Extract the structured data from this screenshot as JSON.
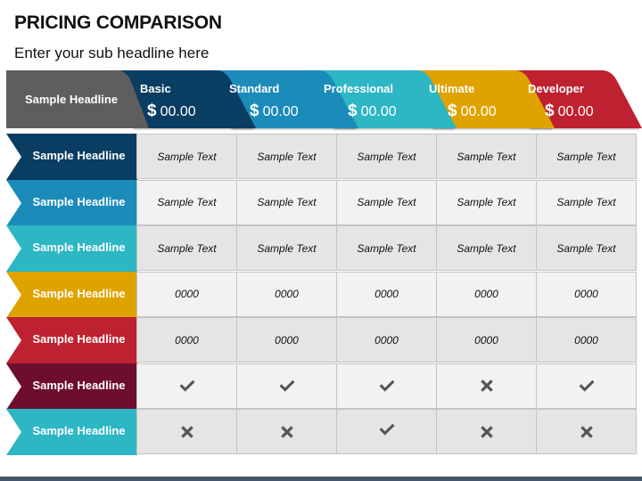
{
  "page": {
    "title": "PRICING COMPARISON",
    "subtitle": "Enter your sub headline here"
  },
  "header": {
    "label": "Sample Headline",
    "label_color": "#5e5e5e",
    "plans": [
      {
        "name": "Basic",
        "currency": "$",
        "price": "00.00",
        "color": "#0a3d62"
      },
      {
        "name": "Standard",
        "currency": "$",
        "price": "00.00",
        "color": "#1b8bba"
      },
      {
        "name": "Professional",
        "currency": "$",
        "price": "00.00",
        "color": "#2db6c4"
      },
      {
        "name": "Ultimate",
        "currency": "$",
        "price": "00.00",
        "color": "#dfa300"
      },
      {
        "name": "Developer",
        "currency": "$",
        "price": "00.00",
        "color": "#be2130"
      }
    ]
  },
  "rows": [
    {
      "label": "Sample Headline",
      "color": "#0a3d62",
      "type": "text",
      "cells": [
        "Sample Text",
        "Sample Text",
        "Sample Text",
        "Sample Text",
        "Sample Text"
      ]
    },
    {
      "label": "Sample Headline",
      "color": "#1b8bba",
      "type": "text",
      "cells": [
        "Sample Text",
        "Sample Text",
        "Sample Text",
        "Sample Text",
        "Sample Text"
      ]
    },
    {
      "label": "Sample Headline",
      "color": "#2db6c4",
      "type": "text",
      "cells": [
        "Sample Text",
        "Sample Text",
        "Sample Text",
        "Sample Text",
        "Sample Text"
      ]
    },
    {
      "label": "Sample Headline",
      "color": "#dfa300",
      "type": "text",
      "cells": [
        "0000",
        "0000",
        "0000",
        "0000",
        "0000"
      ]
    },
    {
      "label": "Sample Headline",
      "color": "#be2130",
      "type": "text",
      "cells": [
        "0000",
        "0000",
        "0000",
        "0000",
        "0000"
      ]
    },
    {
      "label": "Sample Headline",
      "color": "#6d0e31",
      "type": "icon",
      "cells": [
        "check-icon",
        "check-icon",
        "check-icon",
        "cross-icon",
        "check-icon"
      ]
    },
    {
      "label": "Sample Headline",
      "color": "#2db6c4",
      "type": "icon",
      "cells": [
        "cross-icon",
        "cross-icon",
        "check-icon",
        "cross-icon",
        "cross-icon"
      ]
    }
  ],
  "colors": {
    "cell_light": "#f2f2f2",
    "cell_dark": "#e5e5e5",
    "icon": "#555555",
    "footer_bar": "#44546a"
  }
}
